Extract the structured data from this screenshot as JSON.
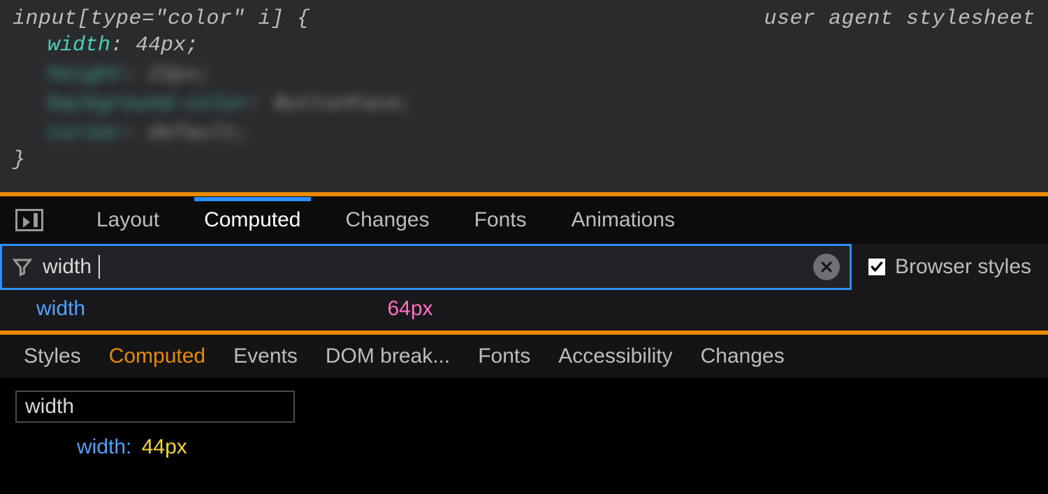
{
  "rule": {
    "selector": "input[type=\"color\" i] {",
    "source": "user agent stylesheet",
    "declarations": [
      {
        "prop": "width",
        "val": "44px",
        "blurred": false
      },
      {
        "prop": "height",
        "val": "23px",
        "blurred": true
      },
      {
        "prop": "background-color",
        "val": "ButtonFace",
        "blurred": true
      },
      {
        "prop": "cursor",
        "val": "default",
        "blurred": true
      }
    ],
    "close": "}"
  },
  "ff": {
    "tabs": {
      "layout": "Layout",
      "computed": "Computed",
      "changes": "Changes",
      "fonts": "Fonts",
      "animations": "Animations"
    },
    "filter_value": "width",
    "browser_styles_label": "Browser styles",
    "browser_styles_checked": true,
    "result": {
      "name": "width",
      "value": "64px"
    }
  },
  "chrome": {
    "tabs": {
      "styles": "Styles",
      "computed": "Computed",
      "events": "Events",
      "dom": "DOM break...",
      "fonts": "Fonts",
      "accessibility": "Accessibility",
      "changes": "Changes"
    },
    "filter_value": "width",
    "result": {
      "prop": "width",
      "value": "44px"
    }
  }
}
